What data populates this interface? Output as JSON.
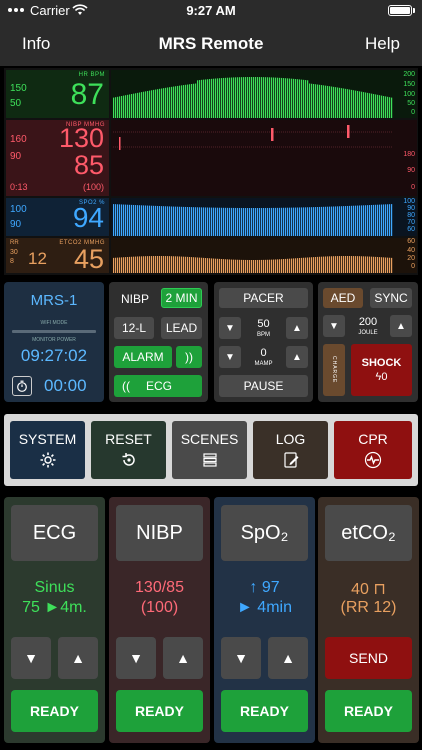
{
  "status_bar": {
    "carrier": "Carrier",
    "time": "9:27 AM"
  },
  "nav": {
    "left": "Info",
    "title": "MRS Remote",
    "right": "Help"
  },
  "monitor": {
    "hr": {
      "label": "HR BPM",
      "value": "87",
      "alarm_high": "150",
      "alarm_low": "50",
      "scale": [
        "200",
        "150",
        "100",
        "50",
        "0"
      ]
    },
    "nibp": {
      "label": "NIBP MMHG",
      "systolic": "130",
      "diastolic": "85",
      "mean": "(100)",
      "alarm_high": "160",
      "alarm_low": "90",
      "elapsed": "0:13",
      "scale": [
        "180",
        "90",
        "0"
      ]
    },
    "spo2": {
      "label": "SPO2 %",
      "value": "94",
      "alarm_high": "100",
      "alarm_low": "90",
      "scale": [
        "100",
        "90",
        "80",
        "70",
        "60"
      ]
    },
    "etco2": {
      "label_rr": "RR",
      "label": "ETCO2 MMHG",
      "rr_high": "30",
      "rr_low": "8",
      "rr": "12",
      "value": "45",
      "scale": [
        "60",
        "40",
        "20",
        "0"
      ]
    }
  },
  "monitor_panel": {
    "device": "MRS-1",
    "wifi_mode": "WIFI MODE",
    "monitor_power": "MONITOR POWER",
    "clock": "09:27:02",
    "timer": "00:00"
  },
  "nibp_panel": {
    "nibp": "NIBP",
    "interval": "2 MIN",
    "lead12": "12-L",
    "lead": "LEAD",
    "alarm": "ALARM",
    "alarm_sound": "))",
    "ecg": "ECG",
    "ecg_sound": "(("
  },
  "pacer_panel": {
    "pacer": "PACER",
    "bpm_value": "50",
    "bpm_unit": "BPM",
    "mamp_value": "0",
    "mamp_unit": "MAMP",
    "pause": "PAUSE"
  },
  "defib_panel": {
    "aed": "AED",
    "sync": "SYNC",
    "joule_value": "200",
    "joule_unit": "JOULE",
    "charge": "CHARGE",
    "shock": "SHOCK",
    "shock_count": "0"
  },
  "menu_row": {
    "system": "SYSTEM",
    "reset": "RESET",
    "scenes": "SCENES",
    "log": "LOG",
    "cpr": "CPR"
  },
  "cards": [
    {
      "title": "ECG",
      "line1": "Sinus",
      "line2": "75 ►4m.",
      "action": "READY"
    },
    {
      "title": "NIBP",
      "line1": "130/85",
      "line2": "(100)",
      "action": "READY"
    },
    {
      "title": "SpO₂",
      "line1": "↑ 97",
      "line2": "► 4min",
      "action": "READY"
    },
    {
      "title": "etCO₂",
      "line1": "40 ⊓",
      "line2": "(RR 12)",
      "action": "READY",
      "send": "SEND"
    }
  ],
  "colors": {
    "hr_green": "#3ee05a",
    "nibp_red": "#ff5a6a",
    "spo2_blue": "#3fa8ff",
    "etco2_orange": "#e8a060",
    "ready_green": "#1ea13a",
    "cpr_red": "#8f1010"
  },
  "icons": [
    "wifi-icon",
    "battery-icon",
    "gear-icon",
    "reset-icon",
    "stack-icon",
    "notepad-icon",
    "heart-pulse-icon",
    "timer-icon",
    "lightning-icon"
  ]
}
